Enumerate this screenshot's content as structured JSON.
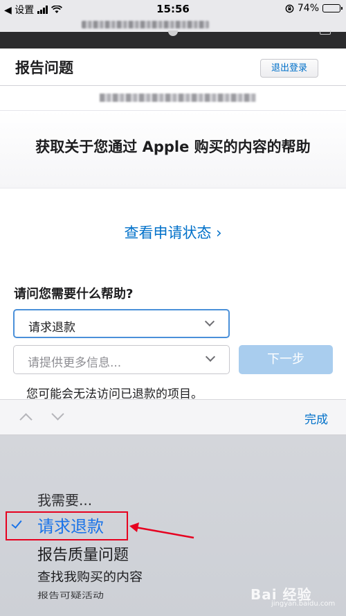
{
  "status_bar": {
    "back_app": "◀ 设置",
    "time": "15:56",
    "battery_percent": "74%",
    "battery_level": 0.74
  },
  "header": {
    "title": "报告问题",
    "signout_label": "退出登录"
  },
  "hero": {
    "title": "获取关于您通过 Apple 购买的内容的帮助"
  },
  "links": {
    "request_status": "查看申请状态 ›"
  },
  "form": {
    "question": "请问您需要什么帮助?",
    "help_type_value": "请求退款",
    "more_info_placeholder": "请提供更多信息...",
    "next_label": "下一步",
    "warning_text": "您可能会无法访问已退款的项目。"
  },
  "accessory": {
    "done_label": "完成"
  },
  "picker": {
    "options": [
      "我需要...",
      "请求退款",
      "报告质量问题",
      "查找我购买的内容",
      "报告可疑活动"
    ],
    "selected_index": 1
  },
  "watermark": {
    "brand": "Bai 经验",
    "url": "jingyan.baidu.com"
  },
  "colors": {
    "link_blue": "#0070c9",
    "picker_selected": "#1a73e8",
    "annotation_red": "#e6001f"
  }
}
